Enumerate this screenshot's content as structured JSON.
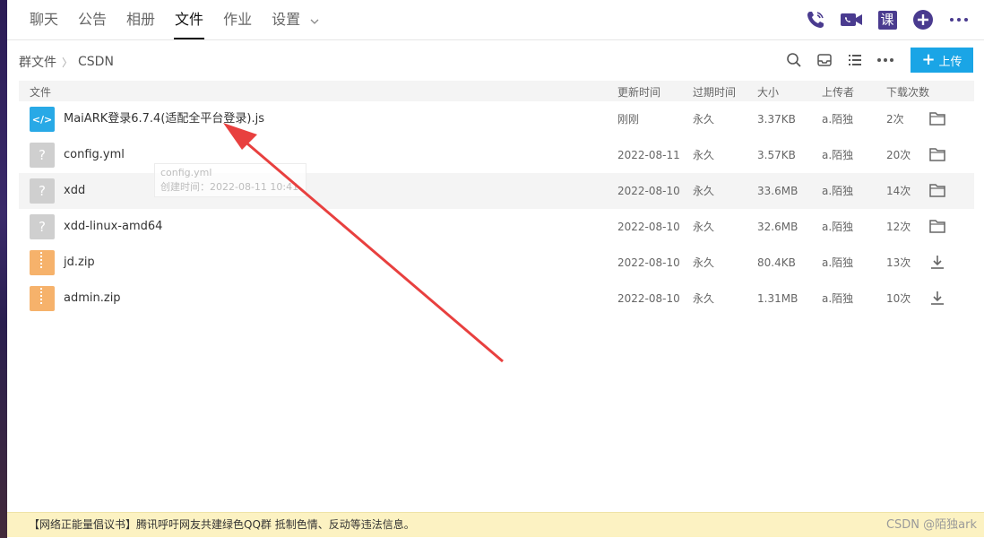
{
  "nav": {
    "tabs": [
      {
        "label": "聊天",
        "active": false
      },
      {
        "label": "公告",
        "active": false
      },
      {
        "label": "相册",
        "active": false
      },
      {
        "label": "文件",
        "active": true
      },
      {
        "label": "作业",
        "active": false
      },
      {
        "label": "设置",
        "active": false
      }
    ],
    "icons": [
      "phone-call-icon",
      "video-call-icon",
      "course-icon",
      "plus-circle-icon",
      "more-icon"
    ],
    "course_glyph": "课"
  },
  "breadcrumb": {
    "root": "群文件",
    "sep": "〉",
    "current": "CSDN"
  },
  "toolbar": {
    "upload_label": "上传",
    "upload_plus": "+"
  },
  "table": {
    "headers": {
      "name": "文件",
      "time": "更新时间",
      "expire": "过期时间",
      "size": "大小",
      "uploader": "上传者",
      "downloads": "下载次数"
    },
    "rows": [
      {
        "name": "MaiARK登录6.7.4(适配全平台登录).js",
        "type": "js",
        "icon_text": "</>",
        "time": "刚刚",
        "expire": "永久",
        "size": "3.37KB",
        "uploader": "a.陌独",
        "downloads": "2次",
        "action": "folder-icon"
      },
      {
        "name": "config.yml",
        "type": "unk",
        "icon_text": "?",
        "time": "2022-08-11",
        "expire": "永久",
        "size": "3.57KB",
        "uploader": "a.陌独",
        "downloads": "20次",
        "action": "folder-icon"
      },
      {
        "name": "xdd",
        "type": "unk",
        "icon_text": "?",
        "time": "2022-08-10",
        "expire": "永久",
        "size": "33.6MB",
        "uploader": "a.陌独",
        "downloads": "14次",
        "action": "folder-icon"
      },
      {
        "name": "xdd-linux-amd64",
        "type": "unk",
        "icon_text": "?",
        "time": "2022-08-10",
        "expire": "永久",
        "size": "32.6MB",
        "uploader": "a.陌独",
        "downloads": "12次",
        "action": "folder-icon"
      },
      {
        "name": "jd.zip",
        "type": "zip",
        "icon_text": "",
        "time": "2022-08-10",
        "expire": "永久",
        "size": "80.4KB",
        "uploader": "a.陌独",
        "downloads": "13次",
        "action": "download-icon"
      },
      {
        "name": "admin.zip",
        "type": "zip",
        "icon_text": "",
        "time": "2022-08-10",
        "expire": "永久",
        "size": "1.31MB",
        "uploader": "a.陌独",
        "downloads": "10次",
        "action": "download-icon"
      }
    ]
  },
  "tooltip": {
    "line1": "config.yml",
    "line2": "创建时间：2022-08-11 10:41"
  },
  "footer": {
    "notice": "【网络正能量倡议书】腾讯呼吁网友共建绿色QQ群 抵制色情、反动等违法信息。",
    "watermark": "CSDN @陌独ark"
  },
  "colors": {
    "accent": "#1aa5e6",
    "nav_icon": "#4a3b8f",
    "arrow": "#e8403f",
    "notice_bg": "#fcf2c2"
  }
}
